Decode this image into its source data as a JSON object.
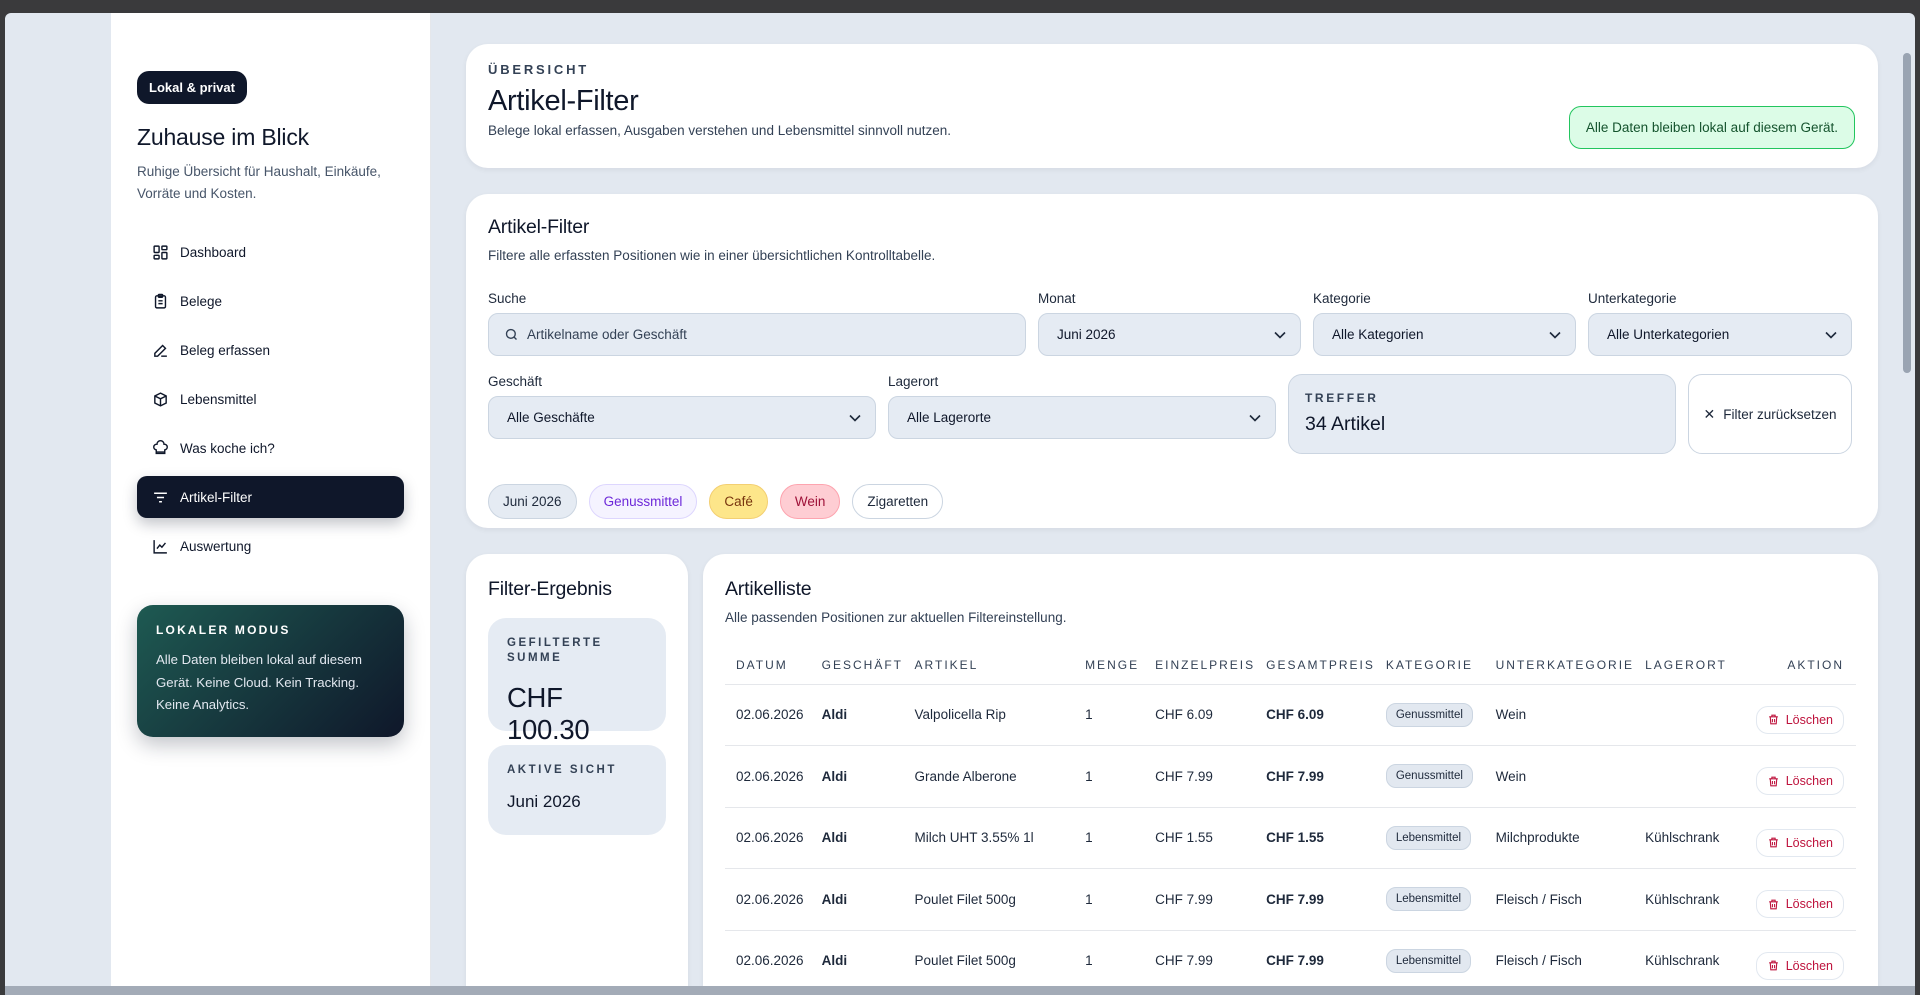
{
  "sidebar": {
    "badge": "Lokal & privat",
    "title": "Zuhause im Blick",
    "subtitle": "Ruhige Übersicht für Haushalt, Einkäufe, Vorräte und Kosten.",
    "nav": [
      {
        "label": "Dashboard",
        "icon": "dashboard-icon"
      },
      {
        "label": "Belege",
        "icon": "receipt-icon"
      },
      {
        "label": "Beleg erfassen",
        "icon": "pencil-icon"
      },
      {
        "label": "Lebensmittel",
        "icon": "box-icon"
      },
      {
        "label": "Was koche ich?",
        "icon": "chef-hat-icon"
      },
      {
        "label": "Artikel-Filter",
        "icon": "filter-icon",
        "active": true
      },
      {
        "label": "Auswertung",
        "icon": "chart-icon"
      }
    ],
    "local_card": {
      "eyebrow": "LOKALER MODUS",
      "text": "Alle Daten bleiben lokal auf diesem Gerät. Keine Cloud. Kein Tracking. Keine Analytics."
    }
  },
  "header": {
    "eyebrow": "ÜBERSICHT",
    "title": "Artikel-Filter",
    "subtitle": "Belege lokal erfassen, Ausgaben verstehen und Lebensmittel sinnvoll nutzen.",
    "privacy_pill": "Alle Daten bleiben lokal auf diesem Gerät."
  },
  "filter": {
    "title": "Artikel-Filter",
    "subtitle": "Filtere alle erfassten Positionen wie in einer übersichtlichen Kontrolltabelle.",
    "search_label": "Suche",
    "search_placeholder": "Artikelname oder Geschäft",
    "month_label": "Monat",
    "month_value": "Juni 2026",
    "category_label": "Kategorie",
    "category_value": "Alle Kategorien",
    "subcategory_label": "Unterkategorie",
    "subcategory_value": "Alle Unterkategorien",
    "store_label": "Geschäft",
    "store_value": "Alle Geschäfte",
    "location_label": "Lagerort",
    "location_value": "Alle Lagerorte",
    "hits_label": "TREFFER",
    "hits_value": "34 Artikel",
    "reset_label": "Filter zurücksetzen",
    "chips": [
      "Juni 2026",
      "Genussmittel",
      "Café",
      "Wein",
      "Zigaretten"
    ]
  },
  "result": {
    "title": "Filter-Ergebnis",
    "sum_label": "GEFILTERTE SUMME",
    "sum_value": "CHF 100.30",
    "view_label": "AKTIVE SICHT",
    "view_value": "Juni 2026"
  },
  "list": {
    "title": "Artikelliste",
    "subtitle": "Alle passenden Positionen zur aktuellen Filtereinstellung.",
    "columns": [
      "DATUM",
      "GESCHÄFT",
      "ARTIKEL",
      "MENGE",
      "EINZELPREIS",
      "GESAMTPREIS",
      "KATEGORIE",
      "UNTERKATEGORIE",
      "LAGERORT",
      "AKTION"
    ],
    "delete_label": "Löschen",
    "rows": [
      {
        "date": "02.06.2026",
        "store": "Aldi",
        "item": "Valpolicella Rip",
        "qty": "1",
        "unit": "CHF 6.09",
        "total": "CHF 6.09",
        "cat": "Genussmittel",
        "sub": "Wein",
        "loc": ""
      },
      {
        "date": "02.06.2026",
        "store": "Aldi",
        "item": "Grande Alberone",
        "qty": "1",
        "unit": "CHF 7.99",
        "total": "CHF 7.99",
        "cat": "Genussmittel",
        "sub": "Wein",
        "loc": ""
      },
      {
        "date": "02.06.2026",
        "store": "Aldi",
        "item": "Milch UHT 3.55% 1l",
        "qty": "1",
        "unit": "CHF 1.55",
        "total": "CHF 1.55",
        "cat": "Lebensmittel",
        "sub": "Milchprodukte",
        "loc": "Kühlschrank"
      },
      {
        "date": "02.06.2026",
        "store": "Aldi",
        "item": "Poulet Filet 500g",
        "qty": "1",
        "unit": "CHF 7.99",
        "total": "CHF 7.99",
        "cat": "Lebensmittel",
        "sub": "Fleisch / Fisch",
        "loc": "Kühlschrank"
      },
      {
        "date": "02.06.2026",
        "store": "Aldi",
        "item": "Poulet Filet 500g",
        "qty": "1",
        "unit": "CHF 7.99",
        "total": "CHF 7.99",
        "cat": "Lebensmittel",
        "sub": "Fleisch / Fisch",
        "loc": "Kühlschrank"
      }
    ]
  }
}
